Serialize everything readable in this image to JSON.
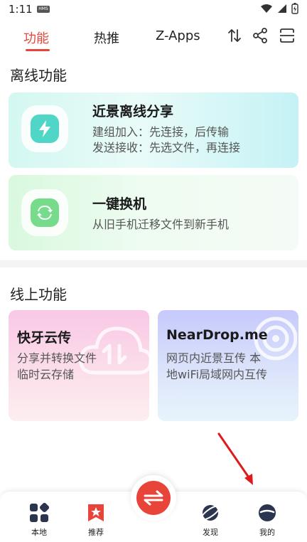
{
  "status_bar": {
    "time": "1:11",
    "hms_badge": "HMS"
  },
  "tabs": [
    {
      "label": "功能",
      "active": true
    },
    {
      "label": "热推",
      "active": false
    },
    {
      "label": "Z-Apps",
      "active": false
    }
  ],
  "toolbar_icons": [
    "sort-icon",
    "share-icon",
    "scan-icon"
  ],
  "offline": {
    "title": "离线功能",
    "cards": [
      {
        "title": "近景离线分享",
        "desc_line1": "建组加入：先连接，后传输",
        "desc_line2": "发送接收：先选文件，再连接",
        "icon": "lightning-icon"
      },
      {
        "title": "一键换机",
        "desc_line1": "从旧手机迁移文件到新手机",
        "icon": "swap-arrows-icon"
      }
    ]
  },
  "online": {
    "title": "线上功能",
    "cards": [
      {
        "title": "快牙云传",
        "desc_line1": "分享并转换文件",
        "desc_line2": "临时云存储",
        "icon": "cloud-icon"
      },
      {
        "title": "NearDrop.me",
        "desc_line1": "网页内近景互传 本",
        "desc_line2": "地wiFi局域网内互传",
        "icon": "radar-icon"
      }
    ]
  },
  "bottom_nav": [
    {
      "label": "本地",
      "icon": "apps-grid-icon"
    },
    {
      "label": "推荐",
      "icon": "star-badge-icon"
    },
    {
      "label": "发现",
      "icon": "planet-icon"
    },
    {
      "label": "我的",
      "icon": "profile-icon"
    }
  ],
  "colors": {
    "accent": "#e8443a"
  }
}
